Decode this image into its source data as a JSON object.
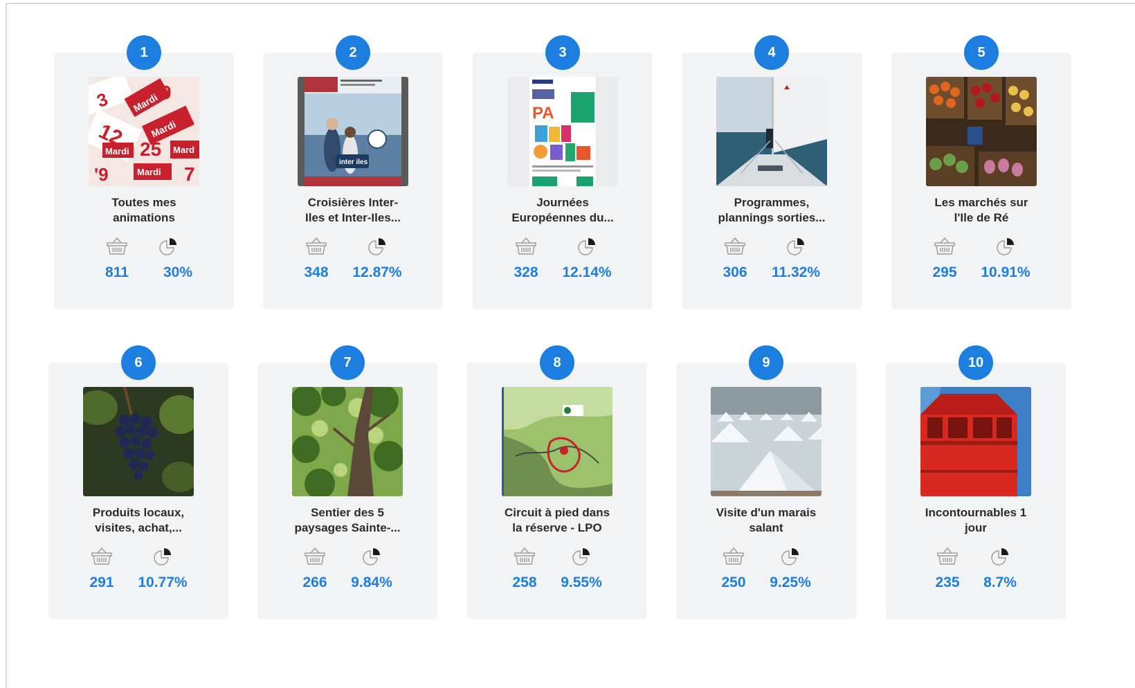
{
  "cards": [
    {
      "rank": "1",
      "title_line1": "Toutes mes",
      "title_line2": "animations",
      "count": "811",
      "percent": "30%",
      "image": "calendar-dates-photo"
    },
    {
      "rank": "2",
      "title_line1": "Croisières Inter-",
      "title_line2": "Iles et Inter-Iles...",
      "count": "348",
      "percent": "12.87%",
      "image": "brochure-couple-boat-photo"
    },
    {
      "rank": "3",
      "title_line1": "Journées",
      "title_line2": "Européennes du...",
      "count": "328",
      "percent": "12.14%",
      "image": "heritage-days-poster"
    },
    {
      "rank": "4",
      "title_line1": "Programmes,",
      "title_line2": "plannings sorties...",
      "count": "306",
      "percent": "11.32%",
      "image": "sailboat-bow-photo"
    },
    {
      "rank": "5",
      "title_line1": "Les marchés sur",
      "title_line2": "l'Ile de Ré",
      "count": "295",
      "percent": "10.91%",
      "image": "market-produce-photo"
    },
    {
      "rank": "6",
      "title_line1": "Produits locaux,",
      "title_line2": "visites, achat,...",
      "count": "291",
      "percent": "10.77%",
      "image": "grapes-vine-photo"
    },
    {
      "rank": "7",
      "title_line1": "Sentier des 5",
      "title_line2": "paysages Sainte-...",
      "count": "266",
      "percent": "9.84%",
      "image": "forest-canopy-photo"
    },
    {
      "rank": "8",
      "title_line1": "Circuit à pied dans",
      "title_line2": "la réserve - LPO",
      "count": "258",
      "percent": "9.55%",
      "image": "nature-reserve-map"
    },
    {
      "rank": "9",
      "title_line1": "Visite d'un marais",
      "title_line2": "salant",
      "count": "250",
      "percent": "9.25%",
      "image": "salt-marsh-photo"
    },
    {
      "rank": "10",
      "title_line1": "Incontournables 1",
      "title_line2": "jour",
      "count": "235",
      "percent": "8.7%",
      "image": "red-lighthouse-photo"
    }
  ],
  "colors": {
    "accent": "#1c7fe0",
    "card_bg": "#f2f3f5",
    "icon_gray": "#9a9a9a"
  }
}
